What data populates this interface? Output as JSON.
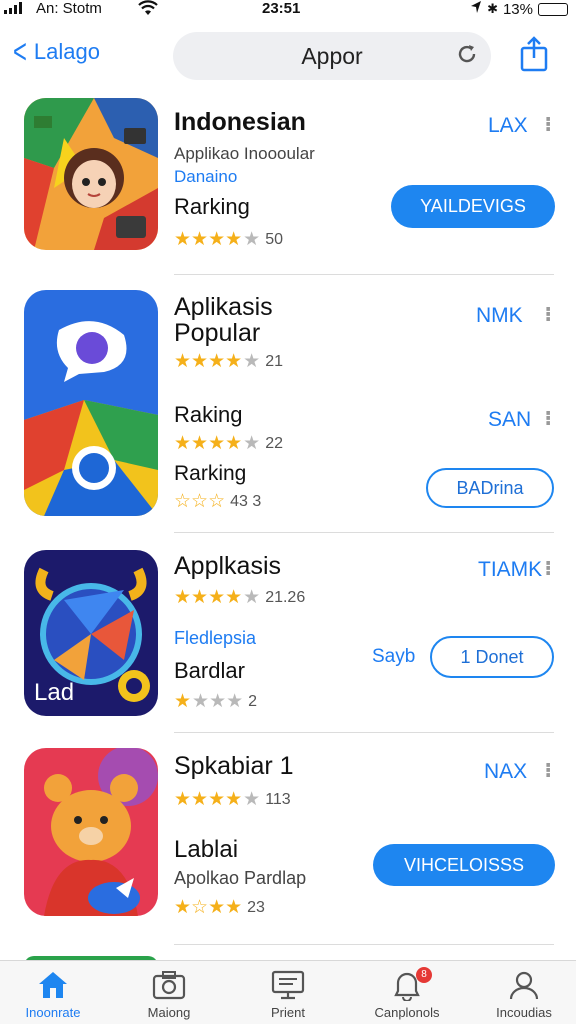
{
  "status_bar": {
    "carrier": "An: Stotm",
    "time": "23:51",
    "battery": "13%",
    "battery_level": 0.13
  },
  "nav": {
    "back_label": "Lalago",
    "search_text": "Appor"
  },
  "apps": [
    {
      "title": "Indonesian",
      "subtitle": "Applikao Inoooular",
      "highlight": "Danaino",
      "label": "Rarking",
      "rating": 4,
      "rating_count": "50",
      "tag": "LAX",
      "button": "YAILDEVIGS"
    },
    {
      "title_line1": "Aplikasis",
      "title_line2": "Popular",
      "rating": 4,
      "rating_count": "21",
      "tag": "NMK",
      "label2": "Raking",
      "rating2": 4,
      "rating2_count": "22",
      "tag2": "SAN",
      "label3": "Rarking",
      "rating3": 3,
      "rating3_count": "43 3",
      "button": "BADrina"
    },
    {
      "title": "Applkasis",
      "rating": 4,
      "rating_count": "21.26",
      "tag": "TIAMK",
      "highlight": "Fledlepsia",
      "label": "Bardlar",
      "rating2": 1,
      "rating2_count": "2",
      "tag2": "Sayb",
      "button": "1 Donet"
    },
    {
      "title": "Spkabiar 1",
      "rating": 4,
      "rating_count": "113",
      "tag": "NAX",
      "label": "Lablai",
      "subtitle": "Apolkao Pardlap",
      "rating2": 3,
      "rating2_count": "23",
      "button": "VIHCELOISSS"
    }
  ],
  "tabs": [
    {
      "label": "Inoonrate",
      "icon": "home-icon",
      "active": true
    },
    {
      "label": "Maiong",
      "icon": "camera-icon",
      "active": false
    },
    {
      "label": "Prient",
      "icon": "monitor-icon",
      "active": false
    },
    {
      "label": "Canplonols",
      "icon": "bell-icon",
      "active": false,
      "badge": "8"
    },
    {
      "label": "Incoudias",
      "icon": "profile-icon",
      "active": false
    }
  ],
  "colors": {
    "accent": "#1e86f0",
    "star": "#f5b01a"
  }
}
